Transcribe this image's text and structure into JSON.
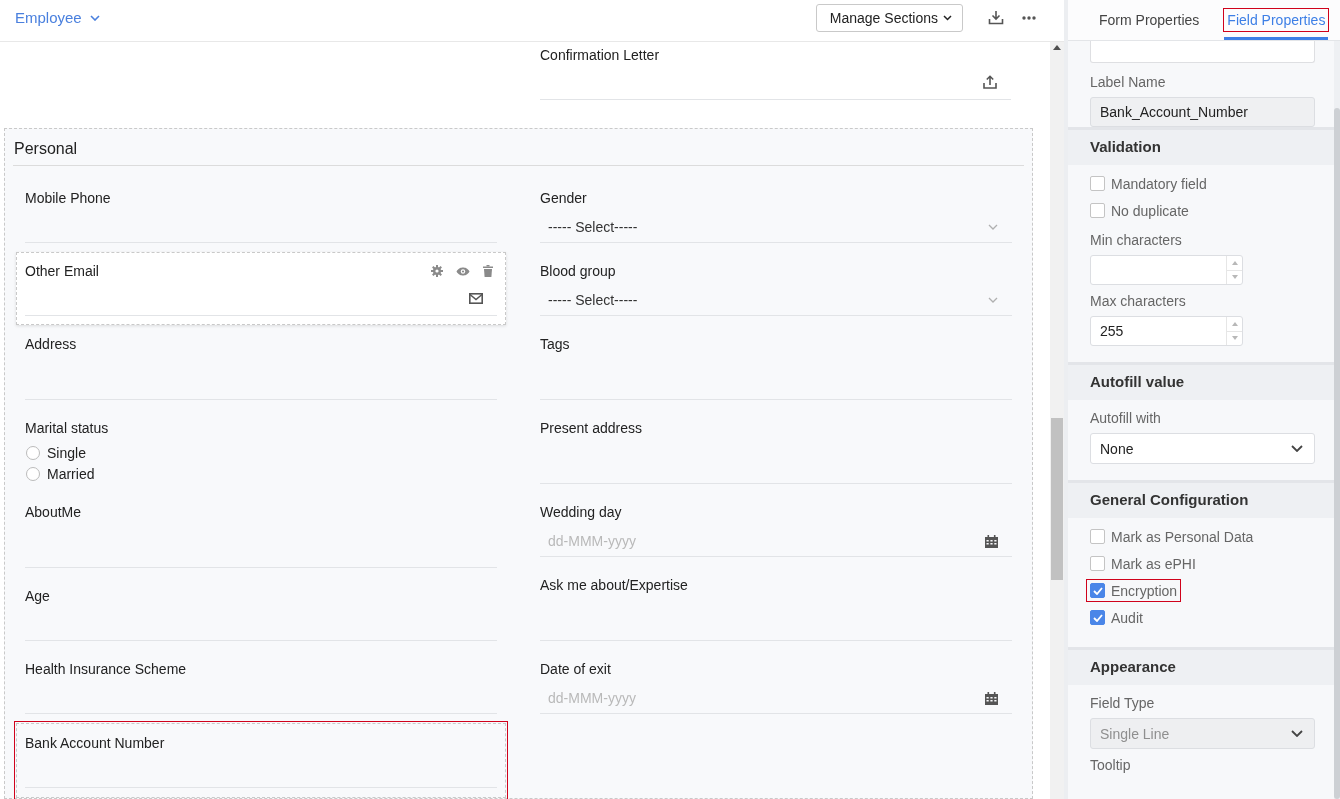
{
  "header": {
    "title": "Employee",
    "manage_button": "Manage Sections"
  },
  "upper_fields": [
    {
      "label": "Confirmation Letter",
      "kind": "file",
      "hovered": false,
      "highlighted": false
    }
  ],
  "section": {
    "title": "Personal",
    "columns": [
      {
        "fields": [
          {
            "label": "Mobile Phone",
            "kind": "text",
            "hovered": false,
            "highlighted": false
          },
          {
            "label": "Other Email",
            "kind": "email",
            "hovered": true,
            "highlighted": false
          },
          {
            "label": "Address",
            "kind": "textarea",
            "hovered": false,
            "highlighted": false
          },
          {
            "label": "Marital status",
            "kind": "radio",
            "hovered": false,
            "highlighted": false,
            "options": [
              {
                "label": "Single",
                "selected": false
              },
              {
                "label": "Married",
                "selected": false
              }
            ]
          },
          {
            "label": "AboutMe",
            "kind": "textarea",
            "hovered": false,
            "highlighted": false
          },
          {
            "label": "Age",
            "kind": "text",
            "hovered": false,
            "highlighted": false
          },
          {
            "label": "Health Insurance Scheme",
            "kind": "text",
            "hovered": false,
            "highlighted": false
          },
          {
            "label": "Bank Account Number",
            "kind": "text",
            "hovered": false,
            "highlighted": true
          }
        ]
      },
      {
        "fields": [
          {
            "label": "Gender",
            "kind": "select",
            "placeholder": "----- Select-----",
            "hovered": false,
            "highlighted": false
          },
          {
            "label": "Blood group",
            "kind": "select",
            "placeholder": "----- Select-----",
            "hovered": false,
            "highlighted": false
          },
          {
            "label": "Tags",
            "kind": "textarea",
            "hovered": false,
            "highlighted": false
          },
          {
            "label": "Present address",
            "kind": "textarea",
            "hovered": false,
            "highlighted": false
          },
          {
            "label": "Wedding day",
            "kind": "date",
            "placeholder": "dd-MMM-yyyy",
            "hovered": false,
            "highlighted": false
          },
          {
            "label": "Ask me about/Expertise",
            "kind": "textarea",
            "hovered": false,
            "highlighted": false
          },
          {
            "label": "Date of exit",
            "kind": "date",
            "placeholder": "dd-MMM-yyyy",
            "hovered": false,
            "highlighted": false
          }
        ]
      }
    ]
  },
  "properties_panel": {
    "tabs": [
      {
        "label": "Form Properties",
        "selected": false,
        "highlighted": false
      },
      {
        "label": "Field Properties",
        "selected": true,
        "highlighted": true
      }
    ],
    "label_name": {
      "label": "Label Name",
      "value": "Bank_Account_Number"
    },
    "groups": [
      {
        "title": "Validation",
        "items": [
          {
            "kind": "checkbox",
            "label": "Mandatory field",
            "checked": false,
            "highlighted": false
          },
          {
            "kind": "checkbox",
            "label": "No duplicate",
            "checked": false,
            "highlighted": false
          },
          {
            "kind": "number",
            "label": "Min characters"
          },
          {
            "kind": "number",
            "label": "Max characters",
            "value": "255"
          }
        ]
      },
      {
        "title": "Autofill value",
        "items": [
          {
            "kind": "select",
            "label": "Autofill with",
            "value": "None",
            "disabled": false
          }
        ]
      },
      {
        "title": "General Configuration",
        "items": [
          {
            "kind": "checkbox",
            "label": "Mark as Personal Data",
            "checked": false,
            "highlighted": false
          },
          {
            "kind": "checkbox",
            "label": "Mark as ePHI",
            "checked": false,
            "highlighted": false
          },
          {
            "kind": "checkbox",
            "label": "Encryption",
            "checked": true,
            "highlighted": true
          },
          {
            "kind": "checkbox",
            "label": "Audit",
            "checked": true,
            "highlighted": false
          }
        ]
      },
      {
        "title": "Appearance",
        "items": [
          {
            "kind": "select",
            "label": "Field Type",
            "value": "Single Line",
            "disabled": true
          },
          {
            "kind": "caption",
            "label": "Tooltip"
          }
        ]
      }
    ]
  }
}
